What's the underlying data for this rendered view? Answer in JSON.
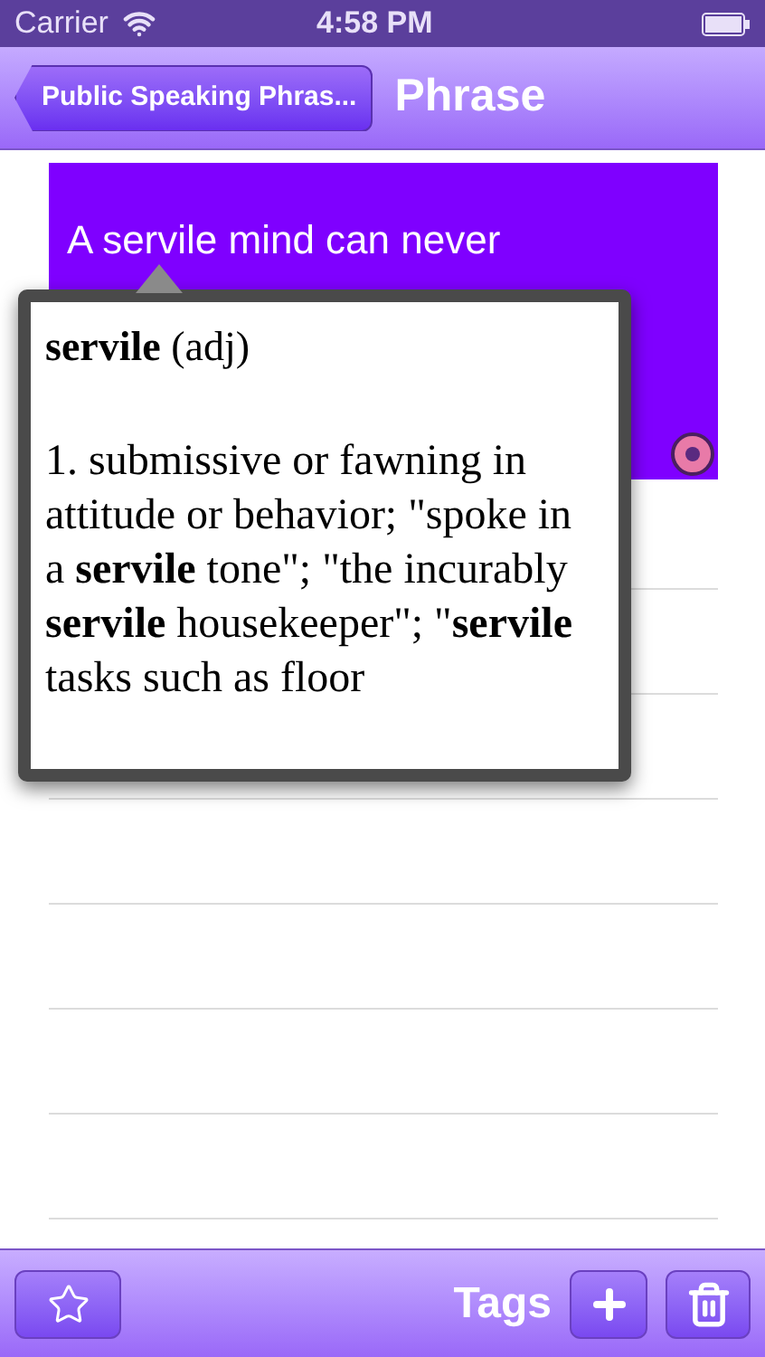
{
  "status_bar": {
    "carrier": "Carrier",
    "time": "4:58 PM"
  },
  "nav_bar": {
    "back_button": "Public Speaking Phras...",
    "title": "Phrase"
  },
  "phrase_card": {
    "text": "A servile mind can never"
  },
  "definition_popup": {
    "heading": "**servile** (adj)",
    "body": "1. submissive or fawning in attitude or behavior; \"spoke in a **servile** tone\"; \"the incurably **servile** housekeeper\"; \"**servile** tasks such as floor"
  },
  "toolbar": {
    "tags_label": "Tags"
  }
}
